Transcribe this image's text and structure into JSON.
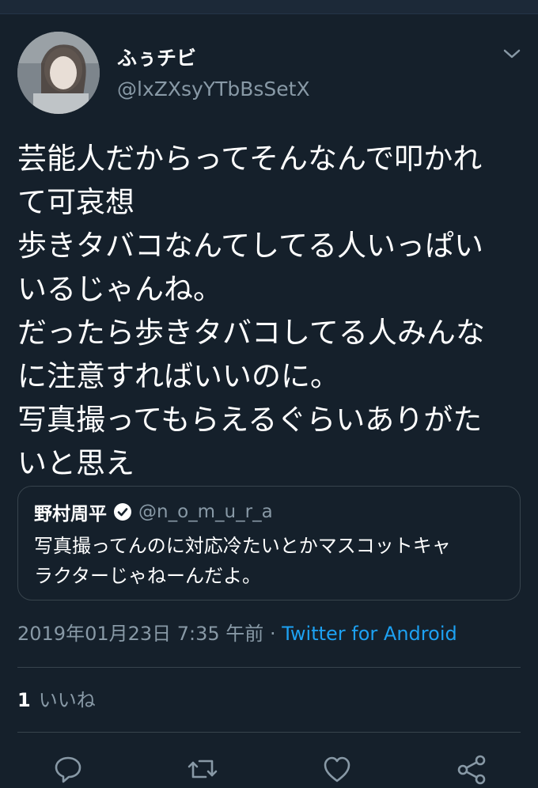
{
  "author": {
    "display_name": "ふぅチビ",
    "handle": "@lxZXsyYTbBsSetX"
  },
  "tweet": {
    "text": "芸能人だからってそんなんで叩かれ\nて可哀想\n歩きタバコなんてしてる人いっぱい\nいるじゃんね。\nだったら歩きタバコしてる人みんな\nに注意すればいいのに。\n写真撮ってもらえるぐらいありがた\nいと思え"
  },
  "quoted_tweet": {
    "display_name": "野村周平",
    "handle": "@n_o_m_u_r_a",
    "text": "写真撮ってんのに対応冷たいとかマスコットキャ\nラクターじゃねーんだよ。"
  },
  "meta": {
    "timestamp": "2019年01月23日 7:35 午前",
    "separator": "·",
    "source": "Twitter for Android"
  },
  "stats": {
    "likes_count": "1",
    "likes_label": "いいね"
  },
  "actions": [
    "reply-icon",
    "retweet-icon",
    "like-icon",
    "share-icon"
  ],
  "colors": {
    "background": "#15202b",
    "secondary_text": "#8899a6",
    "accent": "#1da1f2",
    "border": "#38444d"
  }
}
